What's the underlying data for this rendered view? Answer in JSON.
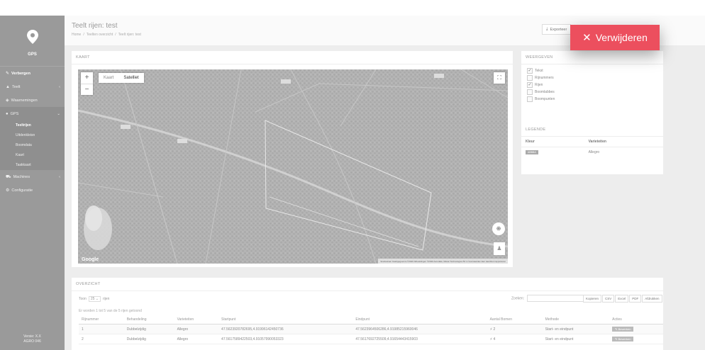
{
  "sidebar": {
    "logo_label": "GPS",
    "items": [
      {
        "icon": "✎",
        "label": "Verbergen",
        "active": true,
        "arrow": ""
      },
      {
        "icon": "▲",
        "label": "Teelt",
        "arrow": "‹"
      },
      {
        "icon": "◈",
        "label": "Waarnemingen",
        "arrow": ""
      },
      {
        "icon": "●",
        "label": "GPS",
        "arrow": "⌄",
        "open": true
      }
    ],
    "sub_items": [
      {
        "label": "Teeltrijen",
        "active": true
      },
      {
        "label": "Uitdenkleisn"
      },
      {
        "label": "Boomdata"
      },
      {
        "label": "Kaart"
      },
      {
        "label": "Taakkaart"
      }
    ],
    "items_after": [
      {
        "icon": "⛟",
        "label": "Machines",
        "arrow": "‹"
      },
      {
        "icon": "⚙",
        "label": "Configuratie",
        "arrow": ""
      }
    ],
    "version_line1": "Versie: X.X",
    "version_line2": "AGRO 046"
  },
  "header": {
    "title": "Teelt rijen: test",
    "breadcrumbs": [
      "Home",
      "/",
      "Teelten overzicht",
      "/",
      "Teelt rijen: test"
    ],
    "export_label": "Exporteer"
  },
  "delete_button": {
    "label": "Verwijderen",
    "color": "#ec4f5e"
  },
  "map_card": {
    "title": "KAART",
    "map_types": [
      "Kaart",
      "Satelliet"
    ],
    "selected_map_type": "Satelliet",
    "google_label": "Google",
    "attribution": "Sneltoetsen   Kaartgegevens ©2020   Afbeeldingen ©2020 Aerodata, Maxar Technologies   50 m   Voorwaarden   Een kaartfout rapporteren"
  },
  "display_card": {
    "title": "WEERGEVEN",
    "options": [
      {
        "label": "Tekst",
        "checked": true
      },
      {
        "label": "Rijnummers",
        "checked": false
      },
      {
        "label": "Rijen",
        "checked": true
      },
      {
        "label": "Boomlabbes",
        "checked": false
      },
      {
        "label": "Boompunten",
        "checked": false
      }
    ]
  },
  "legend_card": {
    "title": "LEGENDE",
    "columns": [
      "Kleur",
      "Varieteiten"
    ],
    "rows": [
      {
        "swatch": "ABBBA",
        "variety": "Allegro"
      }
    ]
  },
  "overview": {
    "title": "OVERZICHT",
    "toon_label": "Toon",
    "toon_value": "25",
    "rijen_label": "rijen",
    "search_label": "Zoeken:",
    "export_buttons": [
      "Kopieren",
      "CSV",
      "Excel",
      "PDF",
      "Afdrukken"
    ],
    "info": "Er worden 1 tot 5 van de 5 rijen getoond",
    "columns": [
      "Rijnummer",
      "Behandeling",
      "Varieteiten",
      "Startpunt",
      "Eindpunt",
      "Aantal Bomen",
      "Methode",
      "Acties"
    ],
    "rows": [
      {
        "nr": "1",
        "behandeling": "Dubbelzijdig",
        "variety": "Allegro",
        "start": "47.5623920782695,4.91996142450736",
        "end": "47.5623964506286,4.91985215960046",
        "bomen": "2",
        "methode": "Start- en eindpunt",
        "actie": "Bewerken"
      },
      {
        "nr": "2",
        "behandeling": "Dubbelzijdig",
        "variety": "Allegro",
        "start": "47.5617589422503,4.91057990053323",
        "end": "47.5617692725509,4.91654443415903",
        "bomen": "4",
        "methode": "Start- en eindpunt",
        "actie": "Bewerken"
      }
    ]
  }
}
